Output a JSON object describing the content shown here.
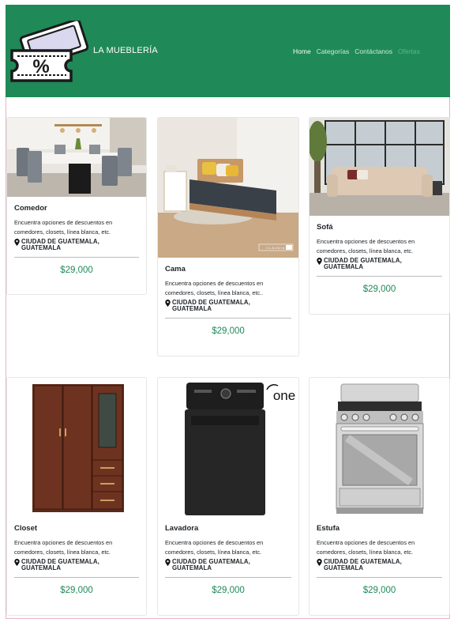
{
  "header": {
    "brand": "LA MUEBLERÍA",
    "nav": [
      {
        "label": "Home"
      },
      {
        "label": "Categorías"
      },
      {
        "label": "Contáctanos"
      },
      {
        "label": "Ofertas"
      }
    ]
  },
  "colors": {
    "header": "#1f8a57",
    "price": "#1f8a57",
    "frame": "#e9b4c4"
  },
  "products": [
    {
      "title": "Comedor",
      "description": "Encuentra opciones de descuentos en comedores, closets, línea blanca, etc.",
      "location": "CIUDAD DE GUATEMALA, GUATEMALA",
      "price": "$29,000",
      "image": "dining-room-photo"
    },
    {
      "title": "Cama",
      "description": "Encuentra opciones de descuentos en comedores, closets, línea blanca, etc..",
      "location": "CIUDAD DE GUATEMALA, GUATEMALA",
      "price": "$29,000",
      "image": "bed-photo",
      "watermark": "CLAUDIA"
    },
    {
      "title": "Sofá",
      "description": "Encuentra opciones de descuentos en comedores, closets, línea blanca, etc.",
      "location": "CIUDAD DE GUATEMALA, GUATEMALA",
      "price": "$29,000",
      "image": "sofa-photo"
    },
    {
      "title": "Closet",
      "description": "Encuentra opciones de descuentos en comedores, closets, línea blanca, etc.",
      "location": "CIUDAD DE GUATEMALA, GUATEMALA",
      "price": "$29,000",
      "image": "closet-photo"
    },
    {
      "title": "Lavadora",
      "description": "Encuentra opciones de descuentos en comedores, closets, línea blanca, etc.",
      "location": "CIUDAD DE GUATEMALA, GUATEMALA",
      "price": "$29,000",
      "image": "washer-photo",
      "logo_text": "one"
    },
    {
      "title": "Estufa",
      "description": "Encuentra opciones de descuentos en comedores, closets, línea blanca, etc.",
      "location": "CIUDAD DE GUATEMALA, GUATEMALA",
      "price": "$29,000",
      "image": "stove-photo"
    }
  ]
}
